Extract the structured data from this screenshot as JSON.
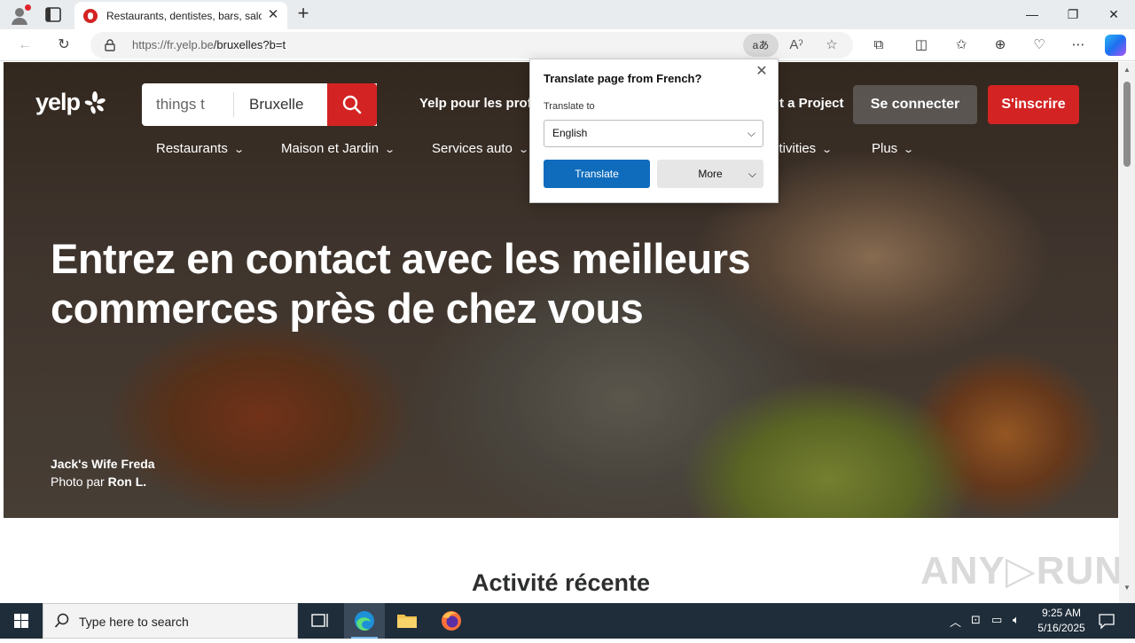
{
  "browser": {
    "tab_title": "Restaurants, dentistes, bars, salon",
    "url_host": "https://fr.yelp.be",
    "url_path": "/bruxelles?b=t",
    "translate_icon_text": "aあ",
    "icons": [
      "profile-icon",
      "tab-actions-icon",
      "close-icon",
      "new-tab-icon",
      "minimize-icon",
      "restore-icon",
      "close-window-icon",
      "back-icon",
      "refresh-icon",
      "lock-icon",
      "translate-icon",
      "read-aloud-icon",
      "favorite-icon",
      "extensions-icon",
      "split-screen-icon",
      "favorites-icon",
      "collections-icon",
      "performance-icon",
      "more-icon",
      "copilot-icon"
    ]
  },
  "translate_popup": {
    "title": "Translate page from French?",
    "label": "Translate to",
    "selected_language": "English",
    "translate_button": "Translate",
    "more_button": "More"
  },
  "yelp": {
    "logo_text": "yelp",
    "search_find": "things t",
    "search_near": "Bruxelle",
    "nav_business": "Yelp pour les prof",
    "nav_project": "t a Project",
    "login_button": "Se connecter",
    "signup_button": "S'inscrire",
    "categories": [
      {
        "label": "Restaurants"
      },
      {
        "label": "Maison et Jardin"
      },
      {
        "label": "Services auto"
      },
      {
        "label": "ctivities"
      },
      {
        "label": "Plus"
      }
    ],
    "headline_line1": "Entrez en contact avec les meilleurs",
    "headline_line2": "commerces près de chez vous",
    "credit_business": "Jack's Wife Freda",
    "credit_prefix": "Photo par ",
    "credit_author": "Ron L.",
    "section_title": "Activité récente",
    "brand_color": "#d32323"
  },
  "watermark": "ANY▷RUN",
  "taskbar": {
    "search_placeholder": "Type here to search",
    "time": "9:25 AM",
    "date": "5/16/2025",
    "apps": [
      "task-view-icon",
      "edge-icon",
      "file-explorer-icon",
      "firefox-icon"
    ]
  }
}
